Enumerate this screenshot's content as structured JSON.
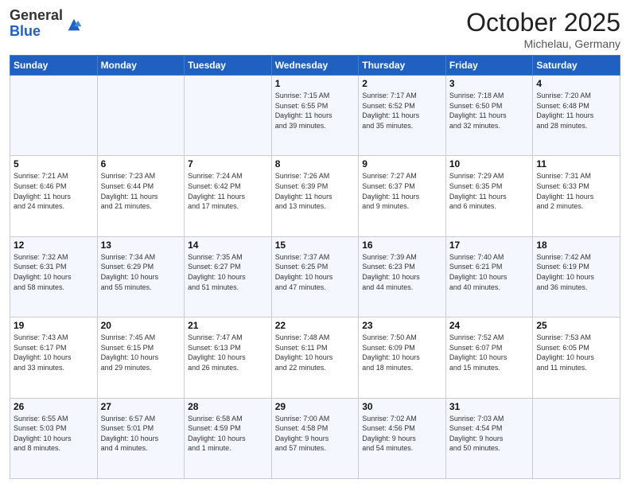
{
  "header": {
    "logo_general": "General",
    "logo_blue": "Blue",
    "month": "October 2025",
    "location": "Michelau, Germany"
  },
  "days_of_week": [
    "Sunday",
    "Monday",
    "Tuesday",
    "Wednesday",
    "Thursday",
    "Friday",
    "Saturday"
  ],
  "weeks": [
    [
      {
        "day": "",
        "info": ""
      },
      {
        "day": "",
        "info": ""
      },
      {
        "day": "",
        "info": ""
      },
      {
        "day": "1",
        "info": "Sunrise: 7:15 AM\nSunset: 6:55 PM\nDaylight: 11 hours\nand 39 minutes."
      },
      {
        "day": "2",
        "info": "Sunrise: 7:17 AM\nSunset: 6:52 PM\nDaylight: 11 hours\nand 35 minutes."
      },
      {
        "day": "3",
        "info": "Sunrise: 7:18 AM\nSunset: 6:50 PM\nDaylight: 11 hours\nand 32 minutes."
      },
      {
        "day": "4",
        "info": "Sunrise: 7:20 AM\nSunset: 6:48 PM\nDaylight: 11 hours\nand 28 minutes."
      }
    ],
    [
      {
        "day": "5",
        "info": "Sunrise: 7:21 AM\nSunset: 6:46 PM\nDaylight: 11 hours\nand 24 minutes."
      },
      {
        "day": "6",
        "info": "Sunrise: 7:23 AM\nSunset: 6:44 PM\nDaylight: 11 hours\nand 21 minutes."
      },
      {
        "day": "7",
        "info": "Sunrise: 7:24 AM\nSunset: 6:42 PM\nDaylight: 11 hours\nand 17 minutes."
      },
      {
        "day": "8",
        "info": "Sunrise: 7:26 AM\nSunset: 6:39 PM\nDaylight: 11 hours\nand 13 minutes."
      },
      {
        "day": "9",
        "info": "Sunrise: 7:27 AM\nSunset: 6:37 PM\nDaylight: 11 hours\nand 9 minutes."
      },
      {
        "day": "10",
        "info": "Sunrise: 7:29 AM\nSunset: 6:35 PM\nDaylight: 11 hours\nand 6 minutes."
      },
      {
        "day": "11",
        "info": "Sunrise: 7:31 AM\nSunset: 6:33 PM\nDaylight: 11 hours\nand 2 minutes."
      }
    ],
    [
      {
        "day": "12",
        "info": "Sunrise: 7:32 AM\nSunset: 6:31 PM\nDaylight: 10 hours\nand 58 minutes."
      },
      {
        "day": "13",
        "info": "Sunrise: 7:34 AM\nSunset: 6:29 PM\nDaylight: 10 hours\nand 55 minutes."
      },
      {
        "day": "14",
        "info": "Sunrise: 7:35 AM\nSunset: 6:27 PM\nDaylight: 10 hours\nand 51 minutes."
      },
      {
        "day": "15",
        "info": "Sunrise: 7:37 AM\nSunset: 6:25 PM\nDaylight: 10 hours\nand 47 minutes."
      },
      {
        "day": "16",
        "info": "Sunrise: 7:39 AM\nSunset: 6:23 PM\nDaylight: 10 hours\nand 44 minutes."
      },
      {
        "day": "17",
        "info": "Sunrise: 7:40 AM\nSunset: 6:21 PM\nDaylight: 10 hours\nand 40 minutes."
      },
      {
        "day": "18",
        "info": "Sunrise: 7:42 AM\nSunset: 6:19 PM\nDaylight: 10 hours\nand 36 minutes."
      }
    ],
    [
      {
        "day": "19",
        "info": "Sunrise: 7:43 AM\nSunset: 6:17 PM\nDaylight: 10 hours\nand 33 minutes."
      },
      {
        "day": "20",
        "info": "Sunrise: 7:45 AM\nSunset: 6:15 PM\nDaylight: 10 hours\nand 29 minutes."
      },
      {
        "day": "21",
        "info": "Sunrise: 7:47 AM\nSunset: 6:13 PM\nDaylight: 10 hours\nand 26 minutes."
      },
      {
        "day": "22",
        "info": "Sunrise: 7:48 AM\nSunset: 6:11 PM\nDaylight: 10 hours\nand 22 minutes."
      },
      {
        "day": "23",
        "info": "Sunrise: 7:50 AM\nSunset: 6:09 PM\nDaylight: 10 hours\nand 18 minutes."
      },
      {
        "day": "24",
        "info": "Sunrise: 7:52 AM\nSunset: 6:07 PM\nDaylight: 10 hours\nand 15 minutes."
      },
      {
        "day": "25",
        "info": "Sunrise: 7:53 AM\nSunset: 6:05 PM\nDaylight: 10 hours\nand 11 minutes."
      }
    ],
    [
      {
        "day": "26",
        "info": "Sunrise: 6:55 AM\nSunset: 5:03 PM\nDaylight: 10 hours\nand 8 minutes."
      },
      {
        "day": "27",
        "info": "Sunrise: 6:57 AM\nSunset: 5:01 PM\nDaylight: 10 hours\nand 4 minutes."
      },
      {
        "day": "28",
        "info": "Sunrise: 6:58 AM\nSunset: 4:59 PM\nDaylight: 10 hours\nand 1 minute."
      },
      {
        "day": "29",
        "info": "Sunrise: 7:00 AM\nSunset: 4:58 PM\nDaylight: 9 hours\nand 57 minutes."
      },
      {
        "day": "30",
        "info": "Sunrise: 7:02 AM\nSunset: 4:56 PM\nDaylight: 9 hours\nand 54 minutes."
      },
      {
        "day": "31",
        "info": "Sunrise: 7:03 AM\nSunset: 4:54 PM\nDaylight: 9 hours\nand 50 minutes."
      },
      {
        "day": "",
        "info": ""
      }
    ]
  ]
}
